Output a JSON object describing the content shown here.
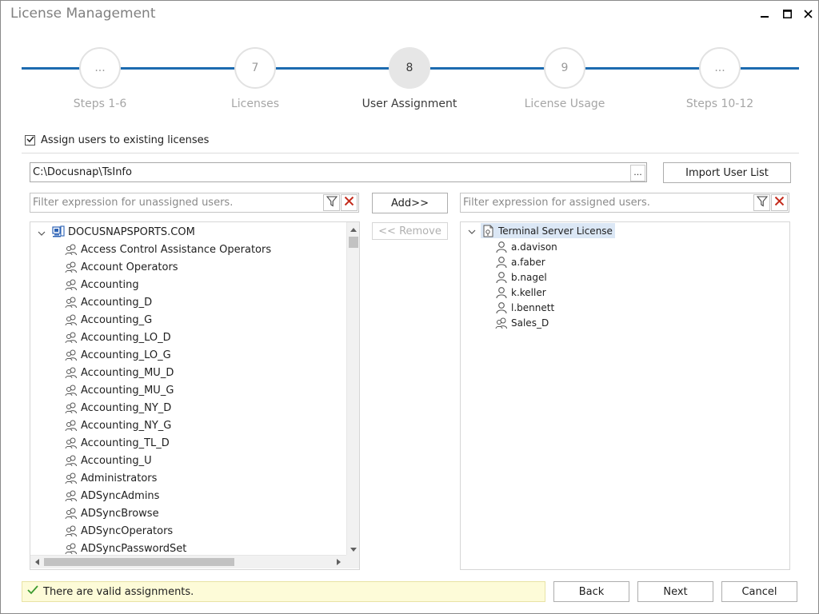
{
  "window": {
    "title": "License Management"
  },
  "stepper": {
    "steps": [
      {
        "number": "...",
        "label": "Steps 1-6",
        "active": false
      },
      {
        "number": "7",
        "label": "Licenses",
        "active": false
      },
      {
        "number": "8",
        "label": "User Assignment",
        "active": true
      },
      {
        "number": "9",
        "label": "License Usage",
        "active": false
      },
      {
        "number": "...",
        "label": "Steps 10-12",
        "active": false
      }
    ]
  },
  "assign": {
    "label": "Assign users to existing licenses",
    "checked": true
  },
  "path": {
    "value": "C:\\Docusnap\\TsInfo",
    "browse_label": "..."
  },
  "buttons": {
    "import": "Import User List",
    "add": "Add>>",
    "remove": "<< Remove",
    "back": "Back",
    "next": "Next",
    "cancel": "Cancel"
  },
  "filters": {
    "unassigned_placeholder": "Filter expression for unassigned users.",
    "assigned_placeholder": "Filter expression for assigned users."
  },
  "unassigned_tree": {
    "root": "DOCUSNAPSPORTS.COM",
    "items": [
      "Access Control Assistance Operators",
      "Account Operators",
      "Accounting",
      "Accounting_D",
      "Accounting_G",
      "Accounting_LO_D",
      "Accounting_LO_G",
      "Accounting_MU_D",
      "Accounting_MU_G",
      "Accounting_NY_D",
      "Accounting_NY_G",
      "Accounting_TL_D",
      "Accounting_U",
      "Administrators",
      "ADSyncAdmins",
      "ADSyncBrowse",
      "ADSyncOperators",
      "ADSyncPasswordSet"
    ]
  },
  "assigned_tree": {
    "root": "Terminal Server License",
    "items": [
      {
        "label": "a.davison",
        "type": "user"
      },
      {
        "label": "a.faber",
        "type": "user"
      },
      {
        "label": "b.nagel",
        "type": "user"
      },
      {
        "label": "k.keller",
        "type": "user"
      },
      {
        "label": "l.bennett",
        "type": "user"
      },
      {
        "label": "Sales_D",
        "type": "group"
      }
    ]
  },
  "status": {
    "text": "There are valid assignments."
  },
  "colors": {
    "accent": "#1c6bb0",
    "status_bg": "#fdfbd8",
    "remove_icon": "#c42b1c",
    "check_green": "#3c9a2f"
  },
  "icons": [
    "minimize-icon",
    "maximize-icon",
    "close-icon",
    "checkmark-icon",
    "filter-icon",
    "clear-filter-icon",
    "domain-icon",
    "group-icon",
    "user-icon",
    "license-icon",
    "chevron-down-icon",
    "scroll-up-icon",
    "scroll-down-icon",
    "scroll-left-icon",
    "scroll-right-icon"
  ]
}
